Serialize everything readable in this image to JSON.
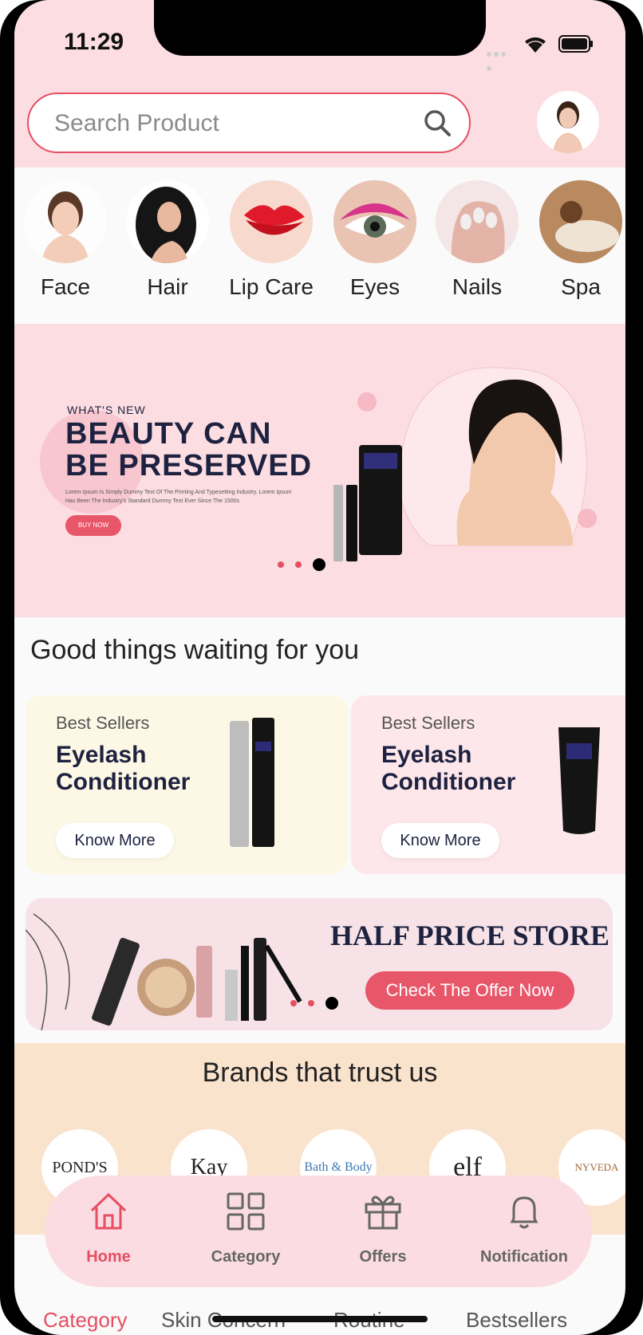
{
  "status_bar": {
    "time": "11:29"
  },
  "search": {
    "placeholder": "Search Product"
  },
  "categories": [
    {
      "label": "Face"
    },
    {
      "label": "Hair"
    },
    {
      "label": "Lip Care"
    },
    {
      "label": "Eyes"
    },
    {
      "label": "Nails"
    },
    {
      "label": "Spa"
    }
  ],
  "hero": {
    "kicker": "WHAT'S NEW",
    "headline_1": "BEAUTY CAN",
    "headline_2": "BE PRESERVED",
    "body": "Lorem Ipsum Is Simply Dummy Text Of The Printing And Typesetting Industry. Lorem Ipsum Has Been The Industry's Standard Dummy Text Ever Since The 1500s",
    "button": "BUY NOW",
    "active_slide": 3,
    "slide_count": 3
  },
  "section_title": "Good things waiting for you",
  "cards": [
    {
      "tag": "Best Sellers",
      "name_1": "Eyelash",
      "name_2": "Conditioner",
      "button": "Know More",
      "bg": "#fdf8e6"
    },
    {
      "tag": "Best Sellers",
      "name_1": "Eyelash",
      "name_2": "Conditioner",
      "button": "Know More",
      "bg": "#fde7ea"
    }
  ],
  "offer": {
    "title": "HALF PRICE STORE",
    "button": "Check The Offer Now",
    "active_slide": 3
  },
  "brands": {
    "title": "Brands that trust us",
    "items": [
      "POND'S",
      "Kay",
      "Bath & Body",
      "elf",
      "NYVEDA"
    ]
  },
  "nav": {
    "items": [
      {
        "label": "Home",
        "icon": "home-icon",
        "active": true
      },
      {
        "label": "Category",
        "icon": "grid-icon",
        "active": false
      },
      {
        "label": "Offers",
        "icon": "gift-icon",
        "active": false
      },
      {
        "label": "Notification",
        "icon": "bell-icon",
        "active": false
      }
    ]
  },
  "subtabs": [
    "Category",
    "Skin Concern",
    "Routine",
    "Bestsellers"
  ],
  "colors": {
    "accent": "#e64e63",
    "pink_bg": "#fcdde2",
    "navy": "#1d2240",
    "peach": "#fae3cd"
  }
}
